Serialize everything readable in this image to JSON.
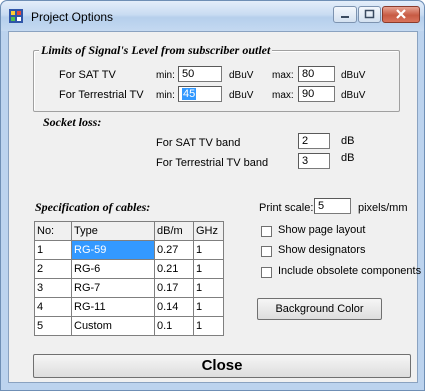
{
  "window": {
    "title": "Project Options"
  },
  "limits": {
    "title": "Limits of Signal's Level from subscriber outlet",
    "sat": {
      "label": "For SAT TV",
      "min_label": "min:",
      "min_value": "50",
      "min_unit": "dBuV",
      "max_label": "max:",
      "max_value": "80",
      "max_unit": "dBuV"
    },
    "terrestrial": {
      "label": "For Terrestrial TV",
      "min_label": "min:",
      "min_value": "45",
      "min_unit": "dBuV",
      "max_label": "max:",
      "max_value": "90",
      "max_unit": "dBuV"
    }
  },
  "socket": {
    "title": "Socket loss:",
    "sat": {
      "label": "For SAT TV band",
      "value": "2",
      "unit": "dB"
    },
    "terrestrial": {
      "label": "For Terrestrial TV band",
      "value": "3",
      "unit": "dB"
    }
  },
  "cables": {
    "title": "Specification of cables:",
    "headers": [
      "No:",
      "Type",
      "dB/m",
      "GHz"
    ],
    "rows": [
      [
        "1",
        "RG-59",
        "0.27",
        "1"
      ],
      [
        "2",
        "RG-6",
        "0.21",
        "1"
      ],
      [
        "3",
        "RG-7",
        "0.17",
        "1"
      ],
      [
        "4",
        "RG-11",
        "0.14",
        "1"
      ],
      [
        "5",
        "Custom",
        "0.1",
        "1"
      ]
    ]
  },
  "print": {
    "label": "Print scale:",
    "value": "5",
    "unit": "pixels/mm"
  },
  "options": {
    "show_page_layout": "Show page layout",
    "show_designators": "Show designators",
    "include_obsolete": "Include obsolete components"
  },
  "background_button": "Background Color",
  "close_button": "Close",
  "colors": {
    "selection": "#3399ff",
    "dialog_bg": "#f0f0f0",
    "frame": "#bcd3ee"
  }
}
